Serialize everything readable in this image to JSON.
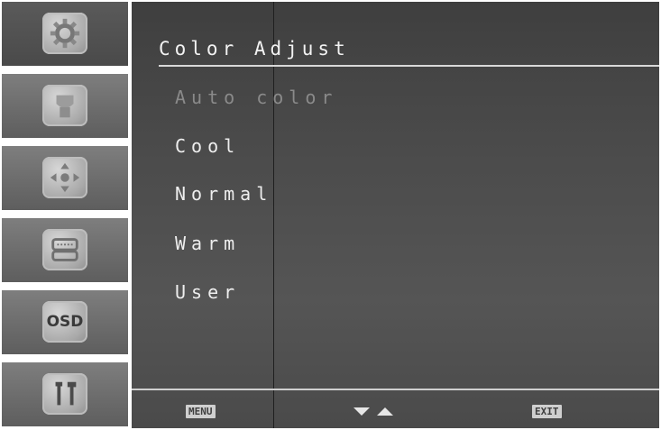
{
  "sidebar": {
    "items": [
      {
        "icon": "gear-icon"
      },
      {
        "icon": "color-adjust-icon"
      },
      {
        "icon": "position-arrows-icon"
      },
      {
        "icon": "input-signal-icon"
      },
      {
        "icon": "osd-icon",
        "label": "OSD"
      },
      {
        "icon": "tools-icon"
      }
    ]
  },
  "panel": {
    "title": "Color Adjust",
    "items": [
      {
        "label": "Auto color",
        "state": "disabled"
      },
      {
        "label": "Cool",
        "state": "normal"
      },
      {
        "label": "Normal",
        "state": "normal"
      },
      {
        "label": "Warm",
        "state": "normal"
      },
      {
        "label": "User",
        "state": "normal"
      }
    ]
  },
  "footer": {
    "menu_label": "MENU",
    "exit_label": "EXIT"
  }
}
